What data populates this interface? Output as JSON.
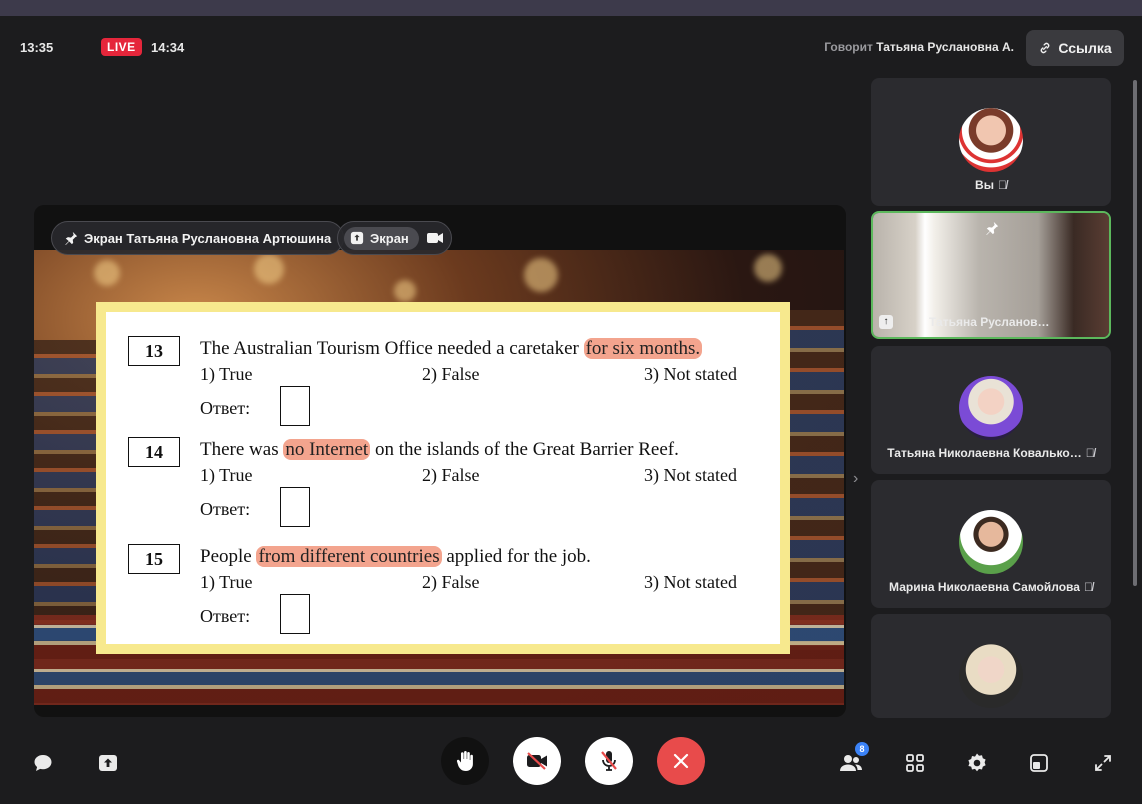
{
  "header": {
    "start_time": "13:35",
    "live_label": "LIVE",
    "current_time": "14:34",
    "speaking_prefix": "Говорит",
    "speaking_name": "Татьяна Руслановна А.",
    "link_button": "Ссылка"
  },
  "stage": {
    "pin_chip_label": "Экран Татьяна Руслановна Артюшина",
    "screen_chip_label": "Экран"
  },
  "worksheet": {
    "answer_label": "Ответ:",
    "options": [
      "1)  True",
      "2)  False",
      "3)  Not stated"
    ],
    "questions": [
      {
        "number": "13",
        "before": "The Australian Tourism Office needed a caretaker ",
        "highlight": "for six months.",
        "after": ""
      },
      {
        "number": "14",
        "before": "There was ",
        "highlight": "no Internet",
        "after": " on the islands of the Great Barrier Reef."
      },
      {
        "number": "15",
        "before": "People ",
        "highlight": "from different countries",
        "after": " applied for the job."
      }
    ]
  },
  "participants": [
    {
      "name": "Вы",
      "muted": true
    },
    {
      "name": "Татьяна Русланов…",
      "muted": false,
      "pinned": true,
      "sharing": true
    },
    {
      "name": "Татьяна Николаевна Ковалько…",
      "muted": true
    },
    {
      "name": "Марина Николаевна Самойлова",
      "muted": true
    },
    {
      "name": "",
      "muted": false
    }
  ],
  "footer": {
    "participants_count": "8"
  },
  "colors": {
    "live": "#e5263b",
    "hangup": "#e84b4b",
    "active_border": "#5cb85c",
    "highlight": "#f3a48e",
    "worksheet_frame": "#f7e98e"
  }
}
